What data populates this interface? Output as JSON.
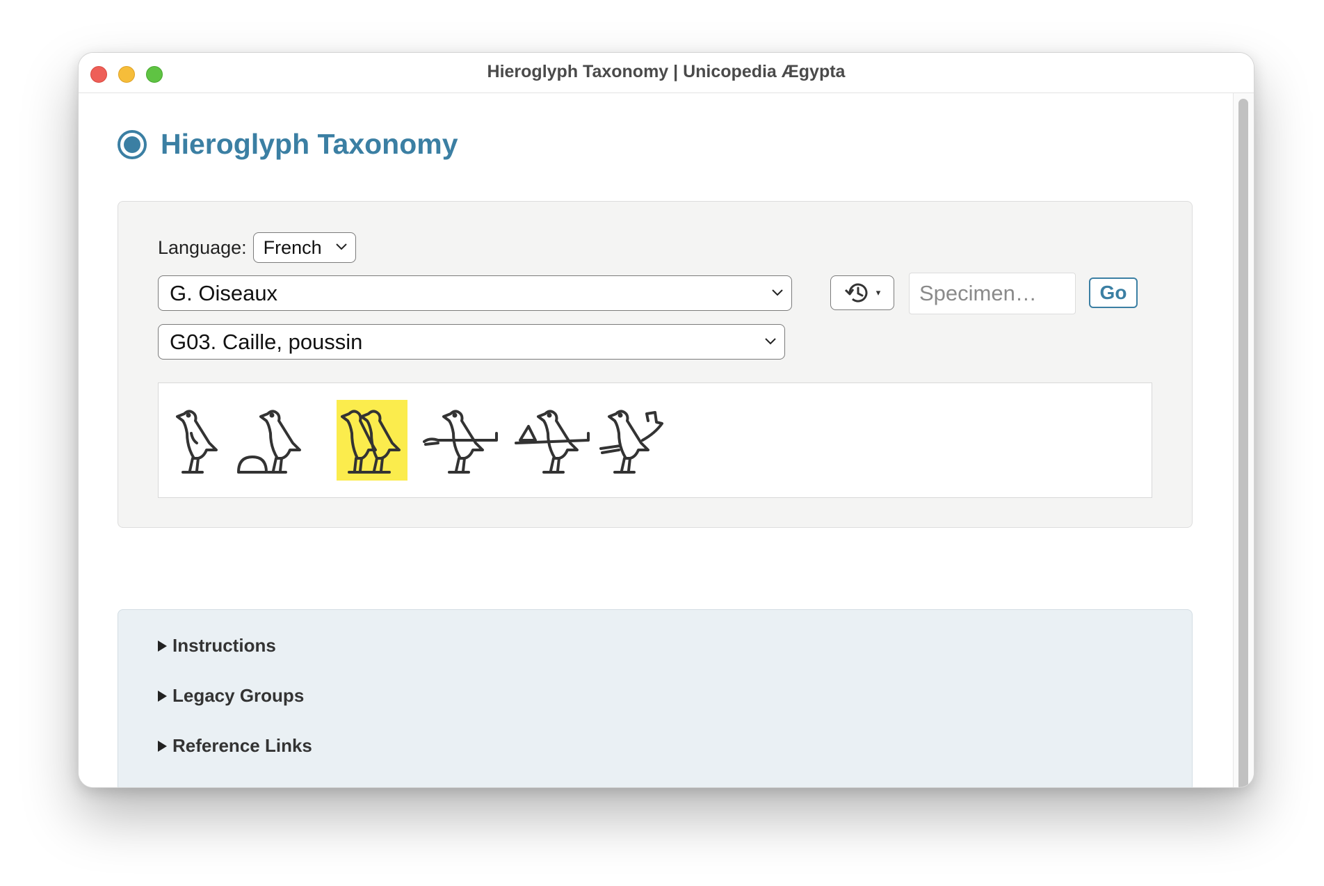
{
  "window": {
    "title": "Hieroglyph Taxonomy | Unicopedia Ægypta"
  },
  "page": {
    "title": "Hieroglyph Taxonomy",
    "title_icon": "radio-button-icon",
    "accent_color": "#3b7fa3"
  },
  "controls": {
    "language_label": "Language:",
    "language_value": "French",
    "group_value": "G. Oiseaux",
    "sign_value": "G03. Caille, poussin",
    "history_icon": "history-icon",
    "history_caret": "▾",
    "specimen_placeholder": "Specimen…",
    "go_label": "Go"
  },
  "glyphs": {
    "count": 6,
    "items": [
      {
        "name": "quail-chick"
      },
      {
        "name": "quail-chick-with-bread-loaf"
      },
      {
        "name": "two-quail-chicks",
        "selected": true
      },
      {
        "name": "quail-chick-with-arm"
      },
      {
        "name": "quail-chick-with-arm-and-loaf"
      },
      {
        "name": "quail-chick-with-foreleg"
      }
    ],
    "highlight_color": "#fbec4d"
  },
  "sections": [
    {
      "label": "Instructions"
    },
    {
      "label": "Legacy Groups"
    },
    {
      "label": "Reference Links"
    }
  ]
}
